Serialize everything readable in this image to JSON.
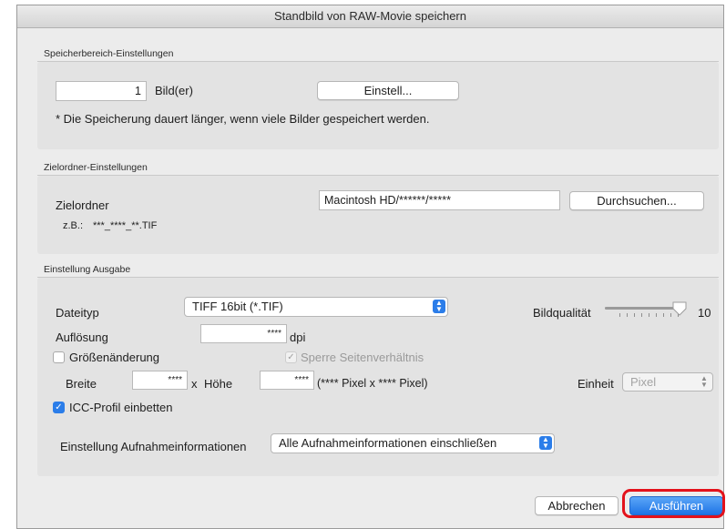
{
  "window": {
    "title": "Standbild von RAW-Movie speichern"
  },
  "save_range": {
    "group_label": "Speicherbereich-Einstellungen",
    "count_value": "1",
    "count_unit": "Bild(er)",
    "settings_button": "Einstell...",
    "note": "* Die Speicherung dauert länger, wenn viele Bilder gespeichert werden."
  },
  "destination": {
    "group_label": "Zielordner-Einstellungen",
    "folder_label": "Zielordner",
    "folder_value": "Macintosh HD/******/*****",
    "browse_button": "Durchsuchen...",
    "example_label": "z.B.:",
    "example_value": "***_****_**.TIF"
  },
  "output": {
    "group_label": "Einstellung Ausgabe",
    "filetype_label": "Dateityp",
    "filetype_value": "TIFF 16bit (*.TIF)",
    "quality_label": "Bildqualität",
    "quality_value": "10",
    "quality_level_fraction": 1.0,
    "resolution_label": "Auflösung",
    "resolution_value": "****",
    "resolution_unit": "dpi",
    "resize_label": "Größenänderung",
    "resize_checked": false,
    "lock_aspect_label": "Sperre Seitenverhältnis",
    "lock_aspect_checked": true,
    "width_label": "Breite",
    "width_value": "****",
    "times": "x",
    "height_label": "Höhe",
    "height_value": "****",
    "pixel_info": "(**** Pixel x **** Pixel)",
    "unit_label": "Einheit",
    "unit_value": "Pixel",
    "icc_label": "ICC-Profil einbetten",
    "icc_checked": true,
    "shooting_info_label": "Einstellung Aufnahmeinformationen",
    "shooting_info_value": "Alle Aufnahmeinformationen einschließen"
  },
  "footer": {
    "cancel_button": "Abbrechen",
    "execute_button": "Ausführen"
  },
  "colors": {
    "accent": "#2b7de9",
    "highlight": "#e3121b",
    "panel": "#e3e3e3",
    "window": "#ececec"
  }
}
